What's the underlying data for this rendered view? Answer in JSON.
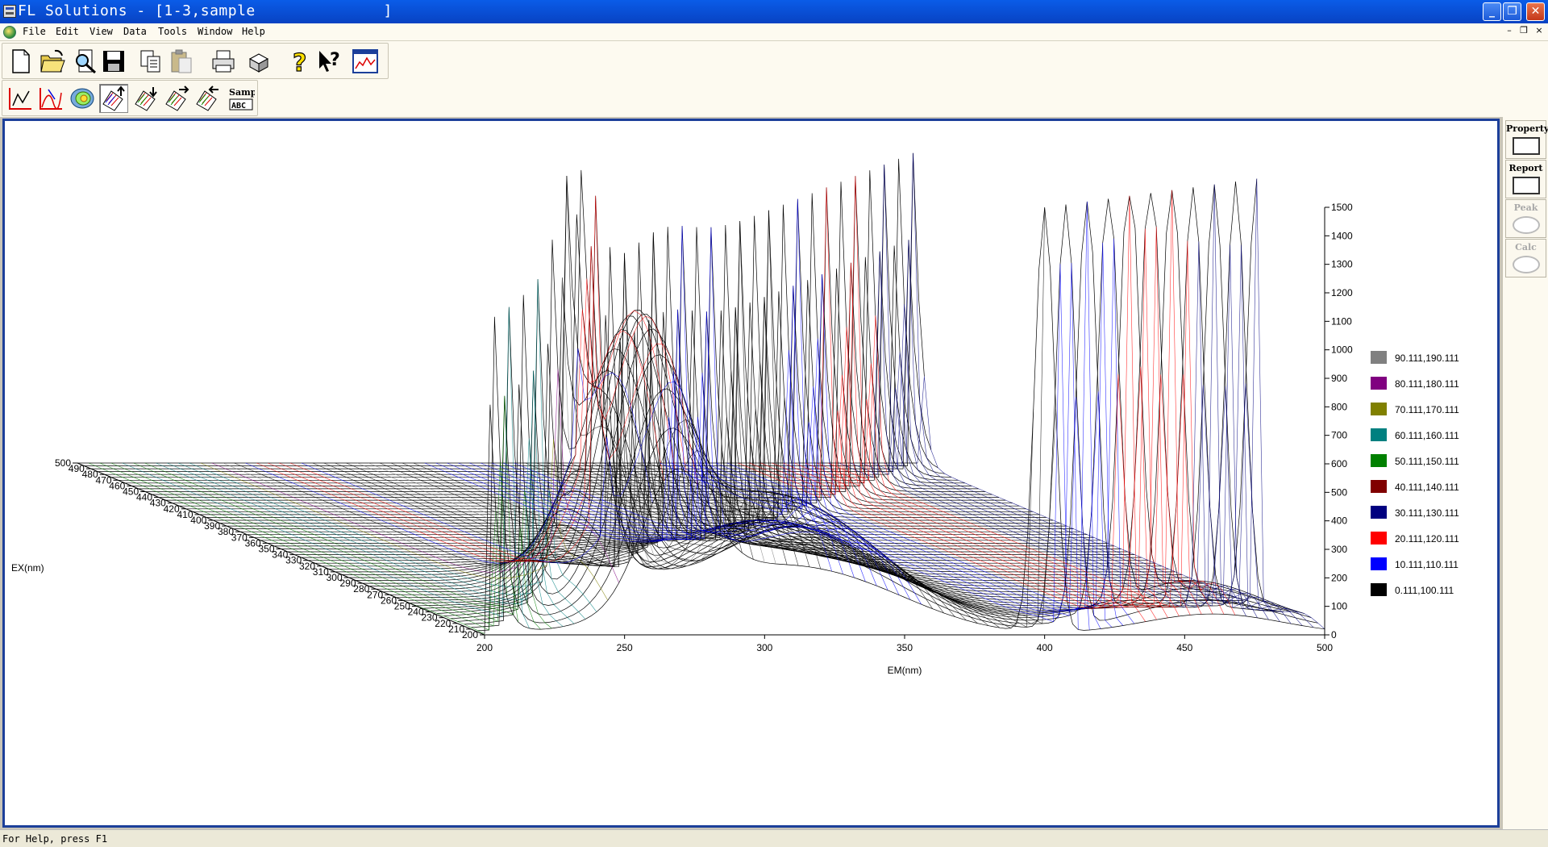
{
  "window": {
    "title": "FL Solutions - [1-3,sample              ]",
    "minimize_glyph": "_",
    "restore_glyph": "❐",
    "close_glyph": "✕"
  },
  "menu": {
    "items": [
      "File",
      "Edit",
      "View",
      "Data",
      "Tools",
      "Window",
      "Help"
    ],
    "mdi_controls": [
      "–",
      "❐",
      "×"
    ]
  },
  "toolbar1": {
    "icons": [
      "new-file-icon",
      "open-folder-icon",
      "search-file-icon",
      "save-icon",
      "copy-icon",
      "paste-icon",
      "print-icon",
      "3d-view-icon",
      "help-icon",
      "context-help-icon",
      "spectrum-window-icon"
    ]
  },
  "toolbar2": {
    "icons": [
      "trace-xy-icon",
      "trace-peak-icon",
      "contour-icon",
      "3d-plot-up-icon",
      "3d-plot-down-icon",
      "3d-plot-right-icon",
      "3d-plot-left-icon",
      "sample-abc-icon"
    ],
    "sample_label_top": "Samp",
    "sample_label_bottom": "ABC",
    "pressed_index": 3
  },
  "right_panel": {
    "buttons": [
      {
        "label": "Property",
        "enabled": true
      },
      {
        "label": "Report",
        "enabled": true
      },
      {
        "label": "Peak",
        "enabled": false
      },
      {
        "label": "Calc",
        "enabled": false
      }
    ]
  },
  "status": {
    "text": "For Help, press F1"
  },
  "chart_data": {
    "type": "3d-surface",
    "xlabel": "EM(nm)",
    "ylabel": "EX(nm)",
    "x_ticks": [
      200,
      250,
      300,
      350,
      400,
      450,
      500
    ],
    "y_ticks": [
      200,
      210,
      220,
      230,
      240,
      250,
      260,
      270,
      280,
      290,
      300,
      310,
      320,
      330,
      340,
      350,
      360,
      370,
      380,
      390,
      400,
      410,
      420,
      430,
      440,
      450,
      460,
      470,
      480,
      490,
      500
    ],
    "z_ticks": [
      0,
      100,
      200,
      300,
      400,
      500,
      600,
      700,
      800,
      900,
      1000,
      1100,
      1200,
      1300,
      1400,
      1500
    ],
    "xlim": [
      200,
      500
    ],
    "ylim": [
      200,
      500
    ],
    "zlim": [
      0,
      1500
    ],
    "legend": [
      {
        "label": "90.111,190.111",
        "color": "#808080"
      },
      {
        "label": "80.111,180.111",
        "color": "#800080"
      },
      {
        "label": "70.111,170.111",
        "color": "#808000"
      },
      {
        "label": "60.111,160.111",
        "color": "#008080"
      },
      {
        "label": "50.111,150.111",
        "color": "#008000"
      },
      {
        "label": "40.111,140.111",
        "color": "#800000"
      },
      {
        "label": "30.111,130.111",
        "color": "#000080"
      },
      {
        "label": "20.111,120.111",
        "color": "#ff0000"
      },
      {
        "label": "10.111,110.111",
        "color": "#0000ff"
      },
      {
        "label": "0.111,100.111",
        "color": "#000000"
      }
    ]
  }
}
